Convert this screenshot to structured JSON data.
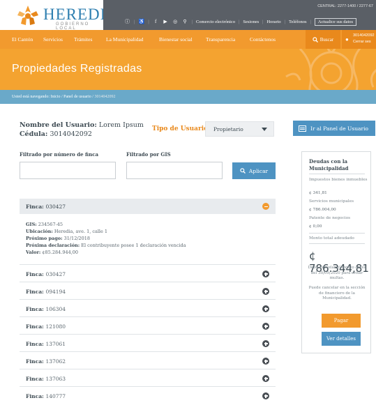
{
  "header": {
    "logo_name": "HEREDIA",
    "logo_sub": "GOBIERNO LOCAL",
    "central_phone": "CENTRAL: 2277-1400 / 2277-67",
    "links": [
      "Comercio electrónico",
      "Sesiones",
      "Horario",
      "Teléfonos"
    ],
    "update_label": "Actualice sus datos",
    "accent_orange": "#f29a2e",
    "accent_blue": "#4e93c2"
  },
  "nav": {
    "items": [
      "El Cantón",
      "Servicios",
      "Trámites",
      "La Municipalidad",
      "Bienestar social",
      "Transparencia",
      "Contáctenos"
    ],
    "search_label": "Buscar",
    "user_code": "3014042092",
    "logout_label": "Cerrar ses"
  },
  "banner": {
    "title": "Propiedades Registradas"
  },
  "breadcrumb": {
    "prefix": "Usted está navegando:",
    "path": "Inicio / Panel de usuario /",
    "current": "3014042092"
  },
  "user": {
    "name_label": "Nombre del Usuario:",
    "name_value": "Lorem Ipsum",
    "id_label": "Cédula:",
    "id_value": "3014042092",
    "tipo_label": "Tipo de Usuario",
    "tipo_value": "Propietario",
    "panel_button": "Ir al Panel de Usuario"
  },
  "filters": {
    "finca_label": "Filtrado por número de finca",
    "gis_label": "Filtrado por GIS",
    "finca_value": "",
    "gis_value": "",
    "apply_label": "Aplicar"
  },
  "open_finca": {
    "label": "Finca:",
    "number": "030427",
    "gis_label": "GIS:",
    "gis_value": "234567-45",
    "ubicacion_label": "Ubicación:",
    "ubicacion_value": "Heredia, ave. 1, calle 1",
    "pago_label": "Próximo pago:",
    "pago_value": "31/12/2018",
    "declaracion_label": "Próxima declaración:",
    "declaracion_value": "El contribuyente posee 1 declaración vencida",
    "valor_label": "Valor:",
    "valor_value": "¢85.284.944,00"
  },
  "fincas": [
    {
      "label": "Finca:",
      "number": "030427"
    },
    {
      "label": "Finca:",
      "number": "094194"
    },
    {
      "label": "Finca:",
      "number": "106304"
    },
    {
      "label": "Finca:",
      "number": "121080"
    },
    {
      "label": "Finca:",
      "number": "137061"
    },
    {
      "label": "Finca:",
      "number": "137062"
    },
    {
      "label": "Finca:",
      "number": "137063"
    },
    {
      "label": "Finca:",
      "number": "140777"
    }
  ],
  "debt": {
    "title": "Deudas con la Municipalidad",
    "impuestos_label": "Impuestos bienes inmuebles",
    "impuestos_value": "¢ 341,81",
    "servicios_label": "Servicios municipales",
    "servicios_value": "¢ 786.004,00",
    "patente_label": "Patente de negocios",
    "patente_value": "¢ 0,00",
    "total_label": "Monto total adeudado",
    "total_value": "¢ 786.344,81",
    "note1": "Debe cancelar el monto antes del 30/09/2020 para evitar multas.",
    "note2": "Puede cancelar en la sección de financiero de la Municipalidad.",
    "pay_label": "Pagar",
    "details_label": "Ver detalles"
  }
}
